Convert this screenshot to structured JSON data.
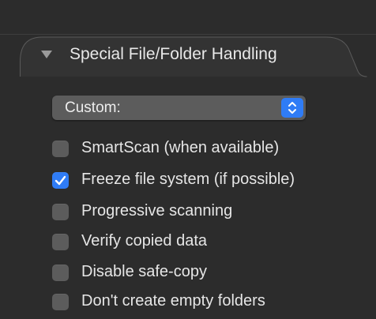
{
  "section": {
    "title": "Special File/Folder Handling",
    "expanded": true
  },
  "preset_popup": {
    "selected": "Custom:"
  },
  "options": [
    {
      "label": "SmartScan (when available)",
      "checked": false
    },
    {
      "label": "Freeze file system (if possible)",
      "checked": true
    },
    {
      "label": "Progressive scanning",
      "checked": false
    },
    {
      "label": "Verify copied data",
      "checked": false
    },
    {
      "label": "Disable safe-copy",
      "checked": false
    },
    {
      "label": "Don't create empty folders",
      "checked": false
    }
  ],
  "colors": {
    "background": "#2c2c2c",
    "control": "#5c5c5c",
    "accent": "#2f7cf6"
  }
}
